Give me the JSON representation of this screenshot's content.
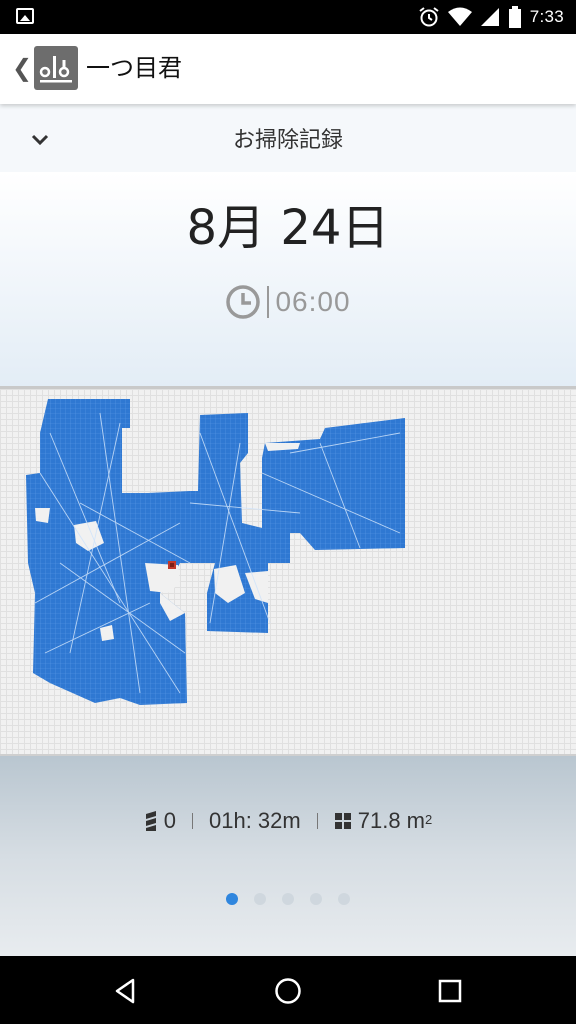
{
  "status_bar": {
    "time": "7:33",
    "icons": [
      "image-icon",
      "alarm-icon",
      "wifi-icon",
      "signal-icon",
      "battery-icon"
    ]
  },
  "app_bar": {
    "back_icon": "back-chevron-icon",
    "logo_icon": "app-logo-icon",
    "title": "一つ目君"
  },
  "record": {
    "collapse_icon": "chevron-down-icon",
    "title": "お掃除記録",
    "date": "8月 24日",
    "start_time": "06:00"
  },
  "map": {
    "fill_color": "#2f78d2",
    "path_color": "#ffffff"
  },
  "stats": {
    "battery_value": "0",
    "duration": "01h: 32m",
    "area_value": "71.8 m",
    "area_unit_exp": "2"
  },
  "pager": {
    "page_count": 5,
    "active_index": 0
  },
  "colors": {
    "accent": "#2f86de",
    "map_blue": "#2f78d2"
  }
}
